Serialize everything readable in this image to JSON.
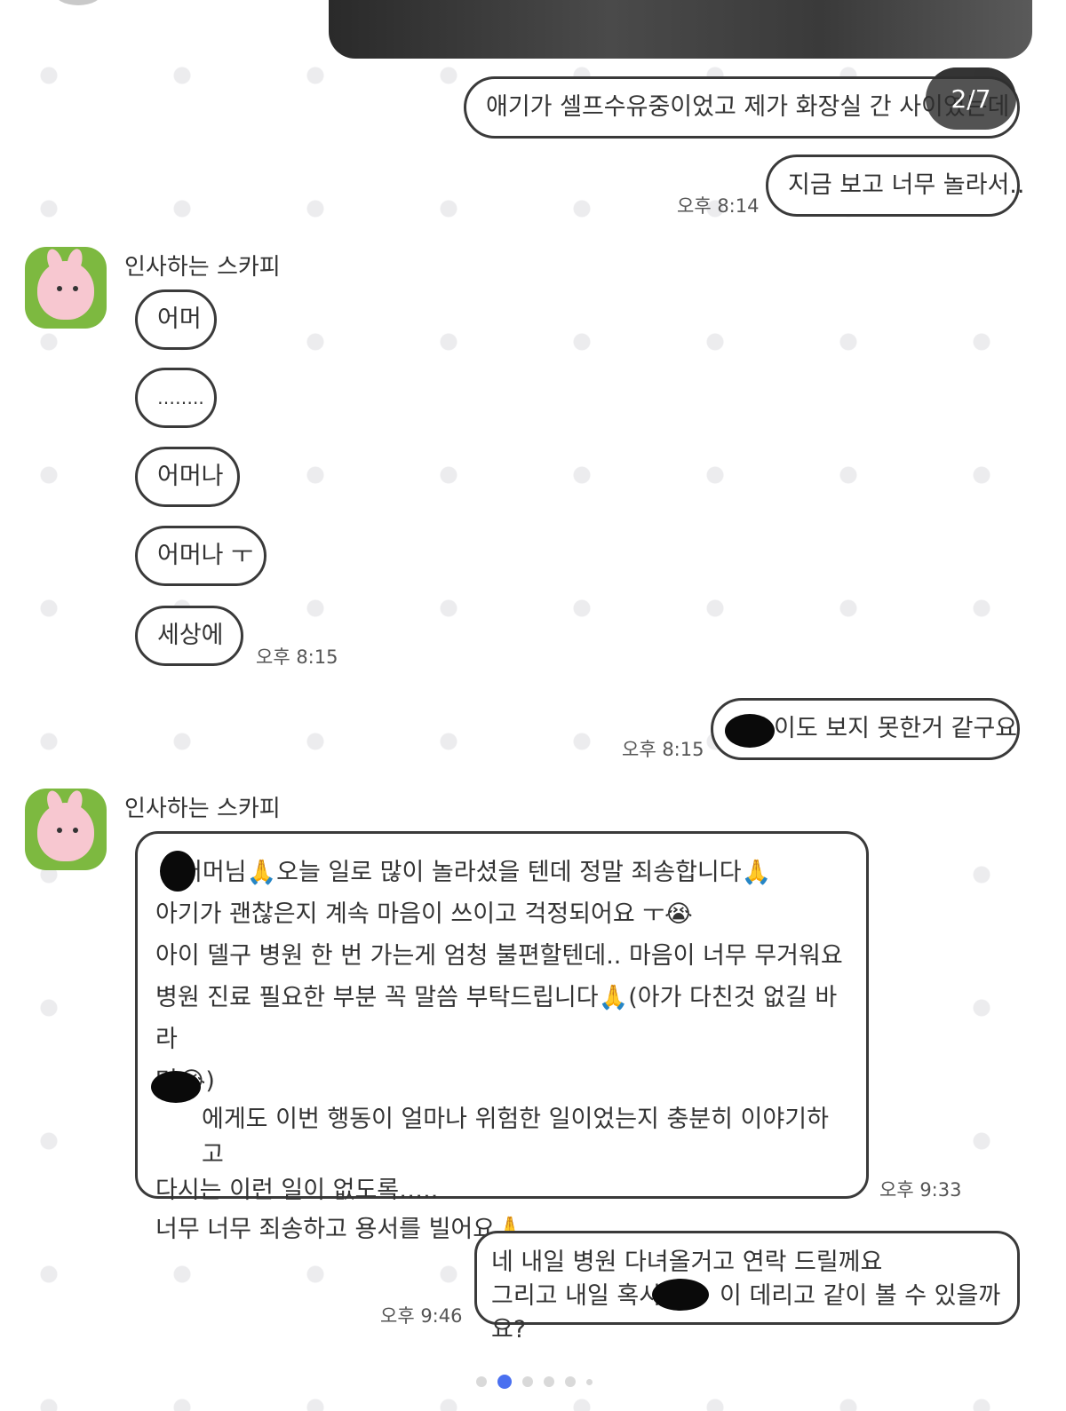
{
  "page_indicator": "2/7",
  "accent_color": "#4a70f0",
  "messages": {
    "m1": "애기가 셀프수유중이었고 제가 화장실 간 사이였는데",
    "m2": "지금 보고 너무 놀라서..",
    "m2_time": "오후 8:14",
    "sender_name": "인사하는 스카피",
    "r1": "어머",
    "r2": "……..",
    "r3": "어머나",
    "r4": "어머나 ㅜ",
    "r5": "세상에",
    "r5_time": "오후 8:15",
    "m3": "이도 보지 못한거 같구요",
    "m3_time": "오후 8:15",
    "sender_name_2": "인사하는 스카피",
    "long_lines": [
      "어머님🙏오늘 일로 많이 놀라셨을 텐데 정말 죄송합니다🙏",
      "아기가 괜찮은지 계속 마음이 쓰이고 걱정되어요 ㅜ😭",
      "아이 델구 병원 한 번 가는게 엄청 불편할텐데.. 마음이 너무 무거워요",
      "병원 진료 필요한 부분  꼭 말씀 부탁드립니다🙏(아가 다친것 없길 바라",
      "며😭)",
      "에게도 이번 행동이 얼마나 위험한 일이었는지 충분히 이야기하고",
      "다시는 이런 일이 없도록…..",
      "너무 너무 죄송하고 용서를 빌어요🙏"
    ],
    "long_time": "오후 9:33",
    "m4_line1": "네 내일 병원 다녀올거고 연락 드릴께요",
    "m4_line2a": "그리고 내일 혹시",
    "m4_line2b": "이 데리고 같이 볼 수 있을까요?",
    "m4_time": "오후 9:46"
  }
}
